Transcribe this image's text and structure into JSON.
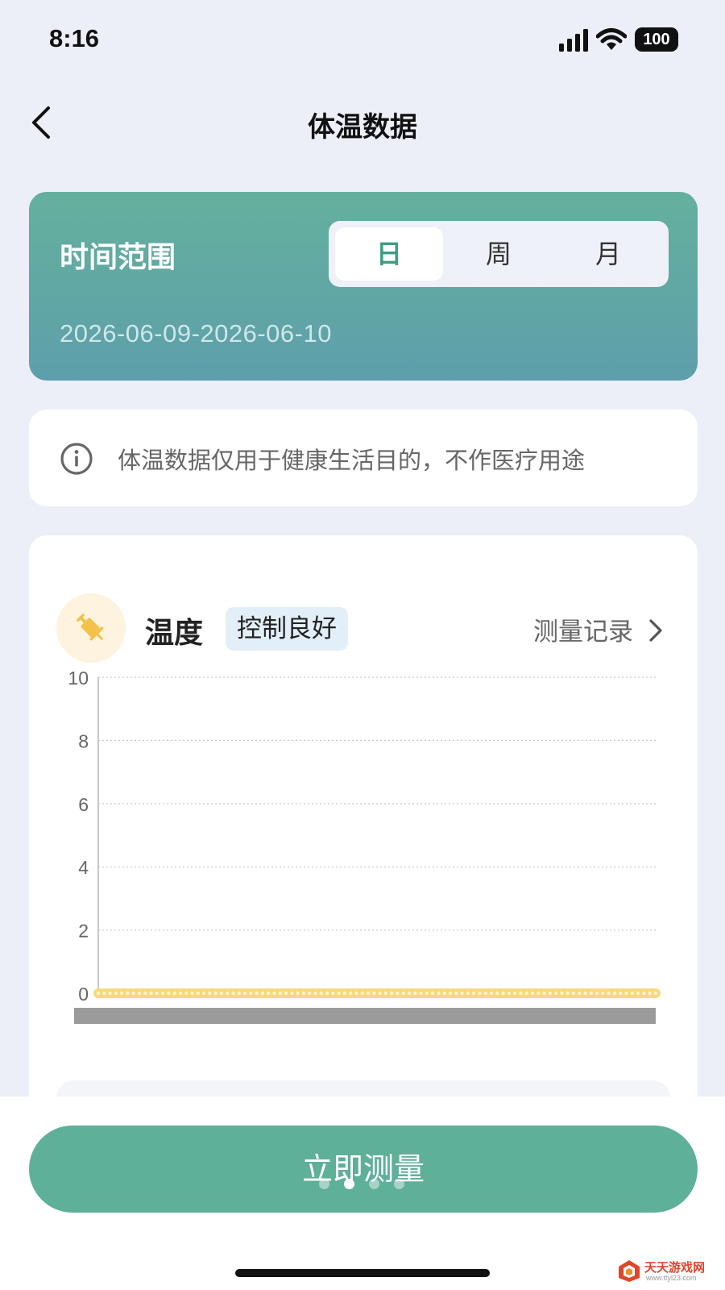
{
  "status_bar": {
    "time": "8:16",
    "battery": "100"
  },
  "nav": {
    "title": "体温数据"
  },
  "range": {
    "label": "时间范围",
    "tabs": [
      {
        "label": "日",
        "active": true
      },
      {
        "label": "周",
        "active": false
      },
      {
        "label": "月",
        "active": false
      }
    ],
    "dates": "2026-06-09-2026-06-10"
  },
  "notice": {
    "text": "体温数据仅用于健康生活目的，不作医疗用途"
  },
  "metric": {
    "title": "温度",
    "badge": "控制良好",
    "records_link": "测量记录"
  },
  "chart_data": {
    "type": "line",
    "ylim": [
      0,
      10
    ],
    "yticks": [
      "10",
      "8",
      "6",
      "4",
      "2",
      "0"
    ],
    "grid": true,
    "series_color": "#f9d87a",
    "values": [
      0,
      0,
      0,
      0,
      0,
      0,
      0,
      0,
      0,
      0,
      0,
      0,
      0,
      0,
      0,
      0,
      0,
      0,
      0,
      0,
      0,
      0,
      0,
      0,
      0,
      0,
      0,
      0,
      0,
      0,
      0,
      0,
      0,
      0,
      0,
      0,
      0,
      0,
      0,
      0,
      0,
      0,
      0,
      0,
      0,
      0,
      0,
      0,
      0,
      0,
      0,
      0,
      0,
      0,
      0,
      0,
      0,
      0,
      0,
      0,
      0,
      0,
      0,
      0,
      0,
      0,
      0,
      0,
      0,
      0,
      0,
      0,
      0,
      0,
      0,
      0,
      0,
      0,
      0,
      0,
      0,
      0,
      0,
      0,
      0,
      0,
      0,
      0,
      0,
      0,
      0,
      0,
      0,
      0,
      0,
      0
    ]
  },
  "actions": {
    "measure_label": "立即测量"
  },
  "pager": {
    "count": 4,
    "active_index": 1
  },
  "colors": {
    "accent": "#5fb098",
    "gradient_start": "#64b09d",
    "gradient_end": "#5e9fab"
  },
  "watermark": {
    "text": "天天游戏网",
    "sub": "www.ttyl23.com"
  }
}
